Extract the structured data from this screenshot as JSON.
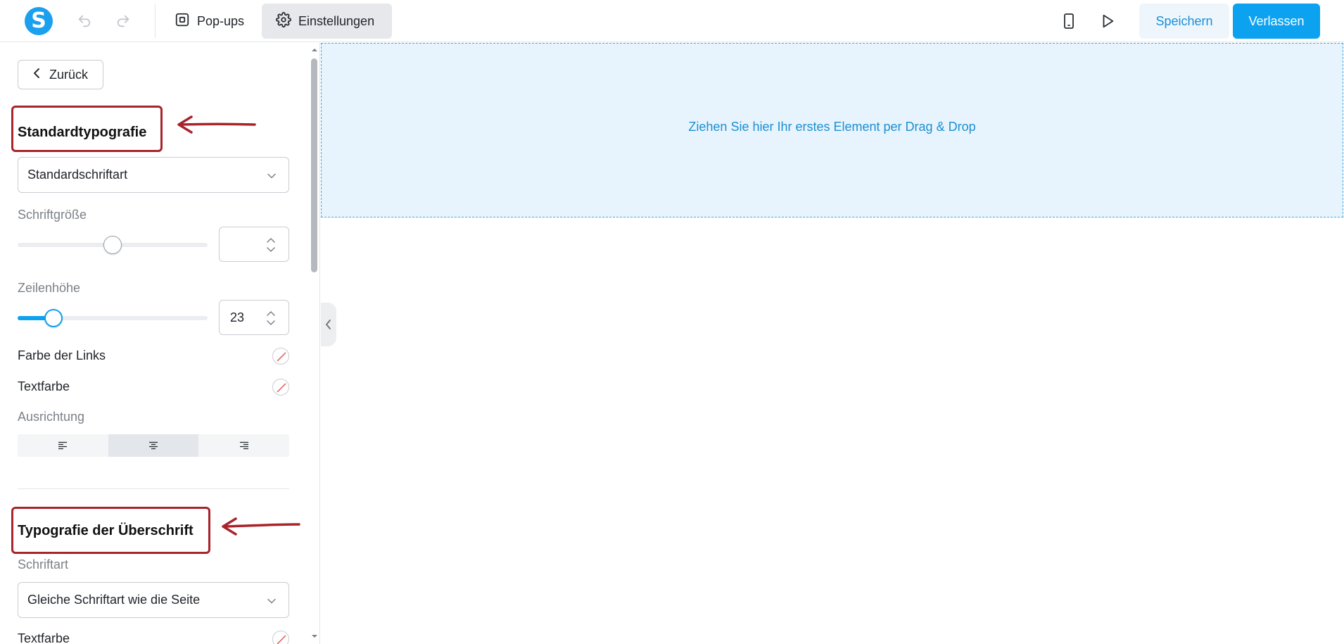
{
  "toolbar": {
    "logo_letter": "S",
    "undo_icon": "undo-icon",
    "redo_icon": "redo-icon",
    "popups_label": "Pop-ups",
    "settings_label": "Einstellungen",
    "mobile_icon": "mobile-preview-icon",
    "play_icon": "play-icon",
    "save_label": "Speichern",
    "exit_label": "Verlassen"
  },
  "sidebar": {
    "back_label": "Zurück",
    "default_typography": {
      "title": "Standardtypografie",
      "font_select_value": "Standardschriftart",
      "font_size_label": "Schriftgröße",
      "font_size_value": "",
      "font_size_slider": 0.5,
      "line_height_label": "Zeilenhöhe",
      "line_height_value": "23",
      "line_height_slider": 0.19,
      "link_color_label": "Farbe der Links",
      "text_color_label": "Textfarbe",
      "alignment_label": "Ausrichtung",
      "alignment_options": [
        "left",
        "center",
        "right"
      ],
      "alignment_selected": "center"
    },
    "heading_typography": {
      "title": "Typografie der Überschrift",
      "font_label": "Schriftart",
      "font_select_value": "Gleiche Schriftart wie die Seite",
      "text_color_label": "Textfarbe"
    }
  },
  "canvas": {
    "dropzone_text": "Ziehen Sie hier Ihr erstes Element per Drag & Drop"
  },
  "colors": {
    "accent": "#0da2f0",
    "annotation": "#a8242b",
    "dropzone_bg": "#e8f4fd"
  }
}
